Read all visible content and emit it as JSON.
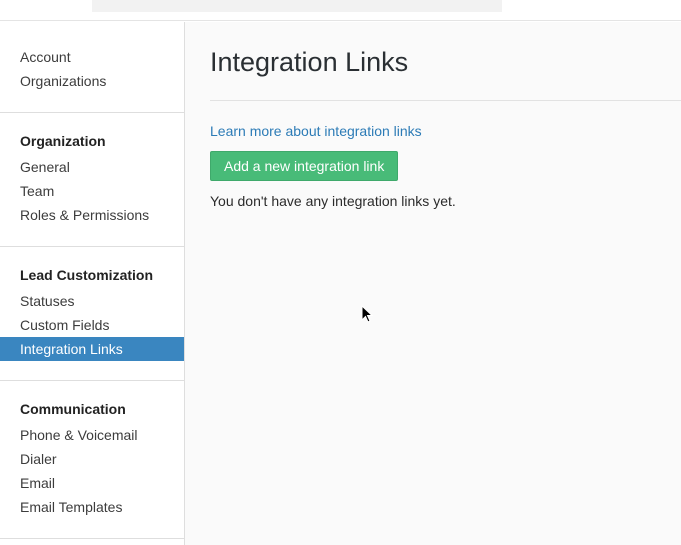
{
  "sidebar": {
    "top_items": [
      {
        "label": "Account"
      },
      {
        "label": "Organizations"
      }
    ],
    "sections": [
      {
        "title": "Organization",
        "items": [
          {
            "label": "General"
          },
          {
            "label": "Team"
          },
          {
            "label": "Roles & Permissions"
          }
        ]
      },
      {
        "title": "Lead Customization",
        "items": [
          {
            "label": "Statuses"
          },
          {
            "label": "Custom Fields"
          },
          {
            "label": "Integration Links",
            "active": true
          }
        ]
      },
      {
        "title": "Communication",
        "items": [
          {
            "label": "Phone & Voicemail"
          },
          {
            "label": "Dialer"
          },
          {
            "label": "Email"
          },
          {
            "label": "Email Templates"
          }
        ]
      }
    ]
  },
  "main": {
    "title": "Integration Links",
    "learn_more_link": "Learn more about integration links",
    "add_button_label": "Add a new integration link",
    "empty_message": "You don't have any integration links yet."
  },
  "colors": {
    "active_item_bg": "#3a86c0",
    "link": "#2c7bb6",
    "button_bg": "#48bb78"
  }
}
